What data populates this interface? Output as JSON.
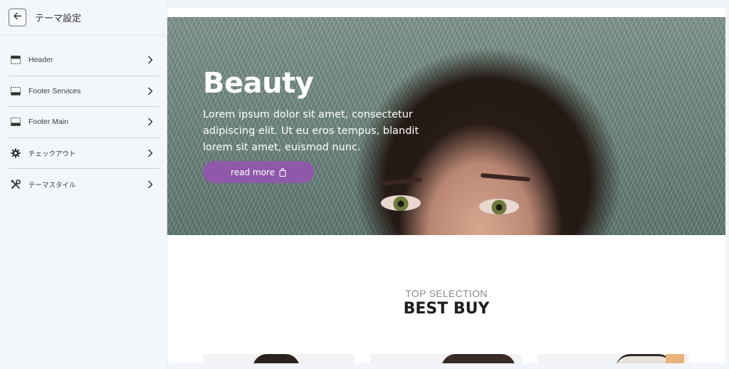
{
  "sidebar": {
    "title": "テーマ設定",
    "back_icon": "arrow-left-icon",
    "items": [
      {
        "label": "Header",
        "icon": "layout-header-icon"
      },
      {
        "label": "Footer Services",
        "icon": "layout-footer-icon"
      },
      {
        "label": "Footer Main",
        "icon": "layout-footer-icon"
      },
      {
        "label": "チェックアウト",
        "icon": "gear-icon"
      },
      {
        "label": "テーマスタイル",
        "icon": "tools-icon"
      }
    ]
  },
  "preview": {
    "hero": {
      "title": "Beauty",
      "body": "Lorem ipsum dolor sit amet, consectetur adipiscing elit. Ut eu eros tempus, blandit lorem sit amet, euismod nunc.",
      "button_label": "read more",
      "button_color": "#8f58a8"
    },
    "section": {
      "subtitle": "TOP SELECTION",
      "title": "BEST BUY"
    }
  }
}
